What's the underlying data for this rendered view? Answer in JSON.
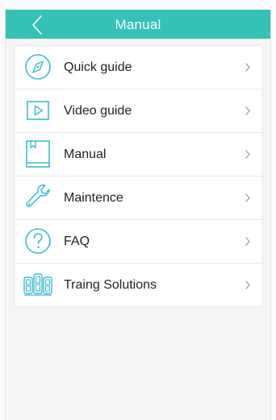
{
  "header": {
    "title": "Manual",
    "back_icon": "chevron-left-icon"
  },
  "menu": {
    "items": [
      {
        "label": "Quick guide",
        "icon": "compass-icon"
      },
      {
        "label": "Video guide",
        "icon": "play-icon"
      },
      {
        "label": "Manual",
        "icon": "book-icon"
      },
      {
        "label": "Maintence",
        "icon": "wrench-icon"
      },
      {
        "label": "FAQ",
        "icon": "question-icon"
      },
      {
        "label": "Traing Solutions",
        "icon": "workout-icon"
      }
    ]
  },
  "colors": {
    "accent": "#35c1b6",
    "icon": "#3bbcd3",
    "text": "#222222",
    "chevron": "#9a9a9a"
  }
}
